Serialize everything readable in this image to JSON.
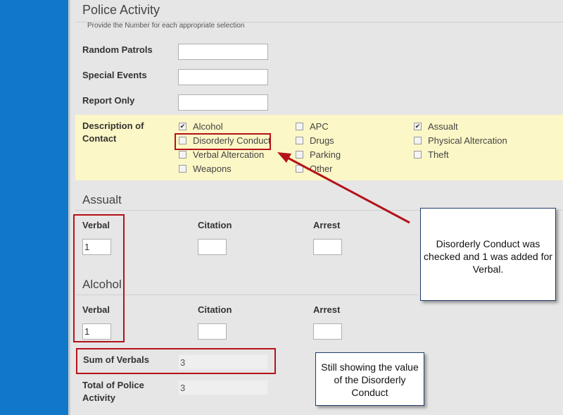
{
  "police_activity": {
    "title": "Police Activity",
    "subtitle": "Provide the Number for each appropriate selection",
    "fields": [
      {
        "label": "Random Patrols",
        "value": ""
      },
      {
        "label": "Special Events",
        "value": ""
      },
      {
        "label": "Report Only",
        "value": ""
      }
    ]
  },
  "description": {
    "label": "Description of Contact",
    "checkboxes": [
      {
        "label": "Alcohol",
        "checked": true
      },
      {
        "label": "APC",
        "checked": false
      },
      {
        "label": "Assualt",
        "checked": true
      },
      {
        "label": "Disorderly Conduct",
        "checked": false
      },
      {
        "label": "Drugs",
        "checked": false
      },
      {
        "label": "Physical Altercation",
        "checked": false
      },
      {
        "label": "Verbal Altercation",
        "checked": false
      },
      {
        "label": "Parking",
        "checked": false
      },
      {
        "label": "Theft",
        "checked": false
      },
      {
        "label": "Weapons",
        "checked": false
      },
      {
        "label": "Other",
        "checked": false
      }
    ]
  },
  "assault": {
    "title": "Assualt",
    "verbal_label": "Verbal",
    "verbal_value": "1",
    "citation_label": "Citation",
    "citation_value": "",
    "arrest_label": "Arrest",
    "arrest_value": ""
  },
  "alcohol": {
    "title": "Alcohol",
    "verbal_label": "Verbal",
    "verbal_value": "1",
    "citation_label": "Citation",
    "citation_value": "",
    "arrest_label": "Arrest",
    "arrest_value": ""
  },
  "totals": {
    "sum_verbals_label": "Sum of Verbals",
    "sum_verbals_value": "3",
    "total_activity_label": "Total of Police Activity",
    "total_activity_value": "3"
  },
  "annotations": {
    "callout1": "Disorderly Conduct was checked and 1 was added for Verbal.",
    "callout2": "Still showing the value of the Disorderly Conduct",
    "highlight_color": "#b4121a"
  }
}
